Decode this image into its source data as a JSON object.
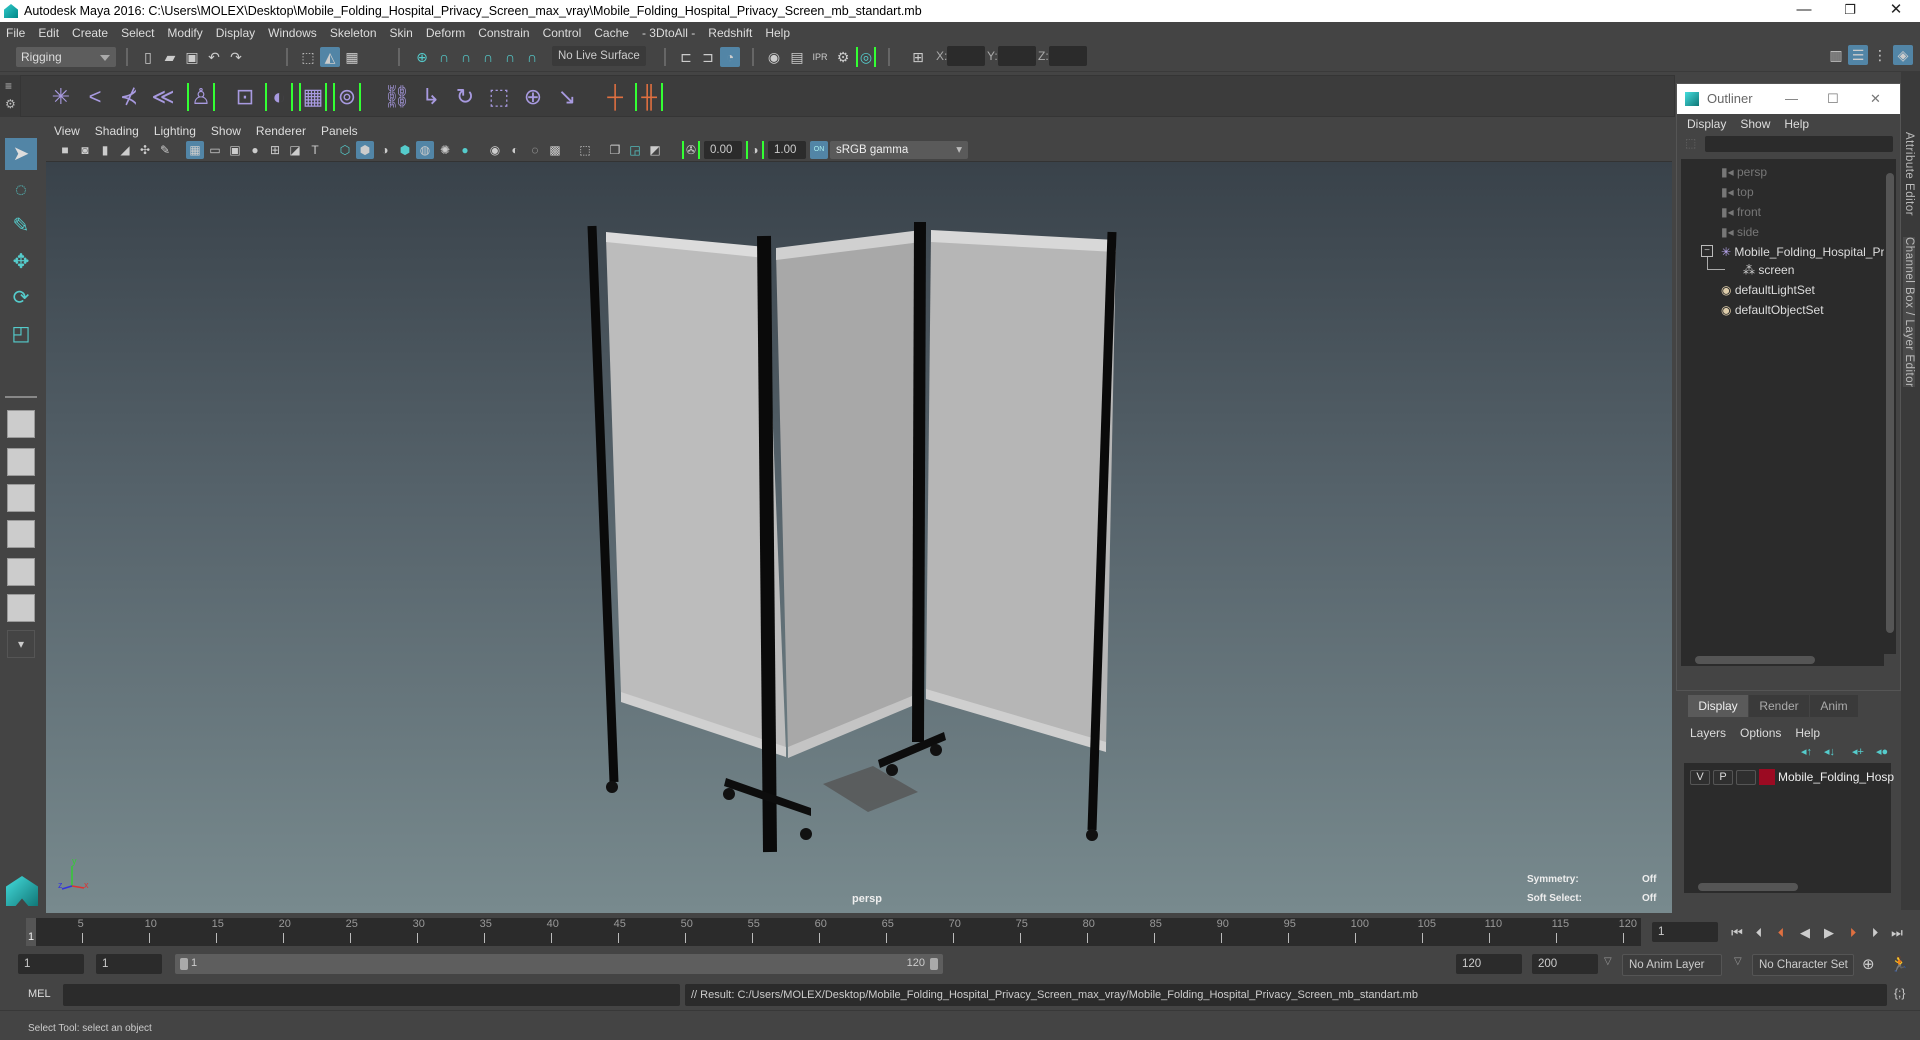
{
  "window": {
    "title": "Autodesk Maya 2016: C:\\Users\\MOLEX\\Desktop\\Mobile_Folding_Hospital_Privacy_Screen_max_vray\\Mobile_Folding_Hospital_Privacy_Screen_mb_standart.mb",
    "minimize": "—",
    "restore": "❐",
    "close": "✕"
  },
  "menubar": [
    "File",
    "Edit",
    "Create",
    "Select",
    "Modify",
    "Display",
    "Windows",
    "Skeleton",
    "Skin",
    "Deform",
    "Constrain",
    "Control",
    "Cache",
    "- 3DtoAll -",
    "Redshift",
    "Help"
  ],
  "status_line": {
    "mode": "Rigging",
    "live_surface": "No Live Surface",
    "x_label": "X:",
    "y_label": "Y:",
    "z_label": "Z:",
    "x_value": "",
    "y_value": "",
    "z_value": ""
  },
  "viewport": {
    "menu": [
      "View",
      "Shading",
      "Lighting",
      "Show",
      "Renderer",
      "Panels"
    ],
    "exposure": "0.00",
    "gamma": "1.00",
    "color_mgmt_toggle": "ON",
    "color_space": "sRGB gamma",
    "camera_label": "persp",
    "hud": {
      "symmetry_label": "Symmetry:",
      "symmetry_value": "Off",
      "soft_select_label": "Soft Select:",
      "soft_select_value": "Off"
    },
    "axis": {
      "x": "x",
      "y": "y",
      "z": "z"
    }
  },
  "outliner": {
    "title": "Outliner",
    "menu": [
      "Display",
      "Show",
      "Help"
    ],
    "search_placeholder": "",
    "items": [
      {
        "label": "persp",
        "type": "camera"
      },
      {
        "label": "top",
        "type": "camera"
      },
      {
        "label": "front",
        "type": "camera"
      },
      {
        "label": "side",
        "type": "camera"
      },
      {
        "label": "Mobile_Folding_Hospital_Pr",
        "type": "group",
        "expanded": true
      },
      {
        "label": "screen",
        "type": "mesh"
      },
      {
        "label": "defaultLightSet",
        "type": "set"
      },
      {
        "label": "defaultObjectSet",
        "type": "set"
      }
    ]
  },
  "side_tabs": [
    "Attribute Editor",
    "Channel Box / Layer Editor"
  ],
  "layer_editor": {
    "tabs": [
      "Display",
      "Render",
      "Anim"
    ],
    "active_tab": "Display",
    "menu": [
      "Layers",
      "Options",
      "Help"
    ],
    "layers": [
      {
        "visible": "V",
        "playback": "P",
        "type": "",
        "color": "#9b0a22",
        "name": "Mobile_Folding_Hosp"
      }
    ]
  },
  "timeline": {
    "start": 1,
    "end": 120,
    "current_frame": "1",
    "current_frame_marker": "1",
    "tick_labels": [
      "5",
      "10",
      "15",
      "20",
      "25",
      "30",
      "35",
      "40",
      "45",
      "50",
      "55",
      "60",
      "65",
      "70",
      "75",
      "80",
      "85",
      "90",
      "95",
      "100",
      "105",
      "110",
      "115",
      "120"
    ]
  },
  "range": {
    "start_time": "1",
    "playback_start": "1",
    "slider_start": "1",
    "slider_end": "120",
    "playback_end": "120",
    "end_time": "200",
    "anim_layer": "No Anim Layer",
    "character_set": "No Character Set"
  },
  "command_line": {
    "language": "MEL",
    "input": "",
    "result": "// Result: C:/Users/MOLEX/Desktop/Mobile_Folding_Hospital_Privacy_Screen_max_vray/Mobile_Folding_Hospital_Privacy_Screen_mb_standart.mb"
  },
  "help_line": "Select Tool: select an object",
  "colors": {
    "accent_selected": "#5285a6",
    "layer_color": "#9b0a22",
    "bracket_green": "#33ff33",
    "maya_teal": "#33bbbb"
  }
}
